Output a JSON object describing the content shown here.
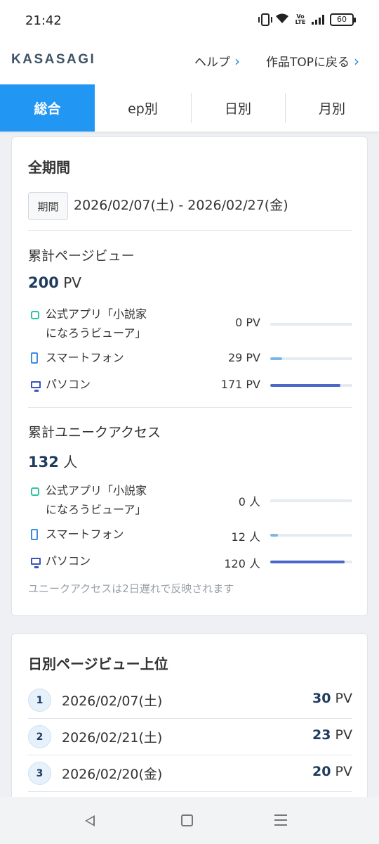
{
  "status_bar": {
    "time": "21:42",
    "volte": "Vo LTE",
    "battery": "60"
  },
  "header": {
    "logo": "KASASAGI",
    "help_link": "ヘルプ",
    "top_link": "作品TOPに戻る",
    "chevron": "〉"
  },
  "tabs": [
    {
      "label": "総合",
      "active": true
    },
    {
      "label": "ep別",
      "active": false
    },
    {
      "label": "日別",
      "active": false
    },
    {
      "label": "月別",
      "active": false
    }
  ],
  "summary": {
    "title": "全期間",
    "period_label": "期間",
    "period_range": "2026/02/07(土) - 2026/02/27(金)",
    "pageviews": {
      "title": "累計ページビュー",
      "total_value": "200",
      "total_unit": "PV",
      "rows": [
        {
          "icon": "app-icon",
          "label_line1": "公式アプリ「小説家",
          "label_line2": "になろうビューア」",
          "value": "0 PV",
          "ratio": 0
        },
        {
          "icon": "smartphone-icon",
          "label": "スマートフォン",
          "value": "29 PV",
          "ratio": 0.145
        },
        {
          "icon": "pc-icon",
          "label": "パソコン",
          "value": "171 PV",
          "ratio": 0.855
        }
      ]
    },
    "unique": {
      "title": "累計ユニークアクセス",
      "total_value": "132",
      "total_unit": "人",
      "rows": [
        {
          "icon": "app-icon",
          "label_line1": "公式アプリ「小説家",
          "label_line2": "になろうビューア」",
          "value": "0 人",
          "ratio": 0
        },
        {
          "icon": "smartphone-icon",
          "label": "スマートフォン",
          "value": "12 人",
          "ratio": 0.091
        },
        {
          "icon": "pc-icon",
          "label": "パソコン",
          "value": "120 人",
          "ratio": 0.909
        }
      ],
      "note": "ユニークアクセスは2日遅れで反映されます"
    }
  },
  "ranking": {
    "title": "日別ページビュー上位",
    "items": [
      {
        "rank": "1",
        "date": "2026/02/07(土)",
        "value": "30",
        "unit": "PV"
      },
      {
        "rank": "2",
        "date": "2026/02/21(土)",
        "value": "23",
        "unit": "PV"
      },
      {
        "rank": "3",
        "date": "2026/02/20(金)",
        "value": "20",
        "unit": "PV"
      }
    ]
  },
  "colors": {
    "accent": "#2196f3",
    "smartphone_bar": "#7fb6e8",
    "pc_bar": "#4a67c9",
    "app_icon": "#2ec4a1",
    "number": "#1f3c5e"
  }
}
